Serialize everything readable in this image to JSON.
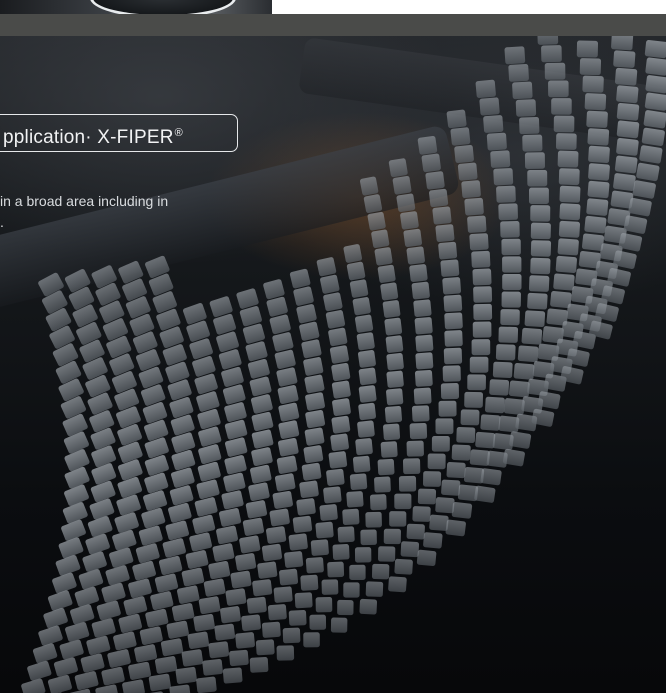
{
  "header": {
    "top_image_name": "product-photo-cropped"
  },
  "hero": {
    "title_text": "pplication· X-FIPER",
    "title_mark": "®",
    "description_line1": "in a broad area including in",
    "description_line2": "."
  },
  "colors": {
    "top_bar": "#4a4b49",
    "background": "#0b0d10",
    "tile": "#8a9096",
    "text": "#f2f3f4"
  },
  "icons": {
    "sensor_graphic": "tile-grid-icon"
  }
}
